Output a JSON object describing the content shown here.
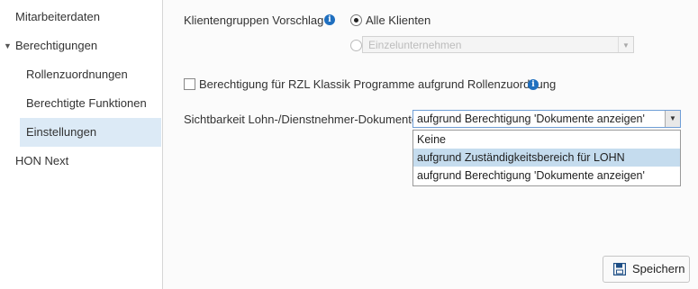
{
  "sidebar": {
    "items": [
      {
        "label": "Mitarbeiterdaten"
      },
      {
        "label": "Berechtigungen"
      },
      {
        "label": "Rollenzuordnungen"
      },
      {
        "label": "Berechtigte Funktionen"
      },
      {
        "label": "Einstellungen"
      },
      {
        "label": "HON Next"
      }
    ],
    "selected_index": 4
  },
  "settings": {
    "client_group_label": "Klientengruppen Vorschlag",
    "radio_all_clients": "Alle Klienten",
    "radio_single_placeholder": "Einzelunternehmen",
    "rzl_checkbox_label": "Berechtigung für RZL Klassik Programme aufgrund Rollenzuordnung",
    "visibility_label": "Sichtbarkeit Lohn-/Dienstnehmer-Dokumente",
    "visibility_value": "aufgrund Berechtigung 'Dokumente anzeigen'",
    "visibility_options": [
      {
        "label": "Keine"
      },
      {
        "label": "aufgrund Zuständigkeitsbereich für LOHN"
      },
      {
        "label": "aufgrund Berechtigung 'Dokumente anzeigen'"
      }
    ],
    "highlighted_option_index": 1
  },
  "footer": {
    "save_label": "Speichern",
    "save_icon": "save-icon"
  },
  "colors": {
    "selected_nav_bg": "#dceaf6",
    "info_icon": "#1f6fbf",
    "highlight_option": "#c5dcee",
    "combo_border": "#6f9ed6"
  }
}
